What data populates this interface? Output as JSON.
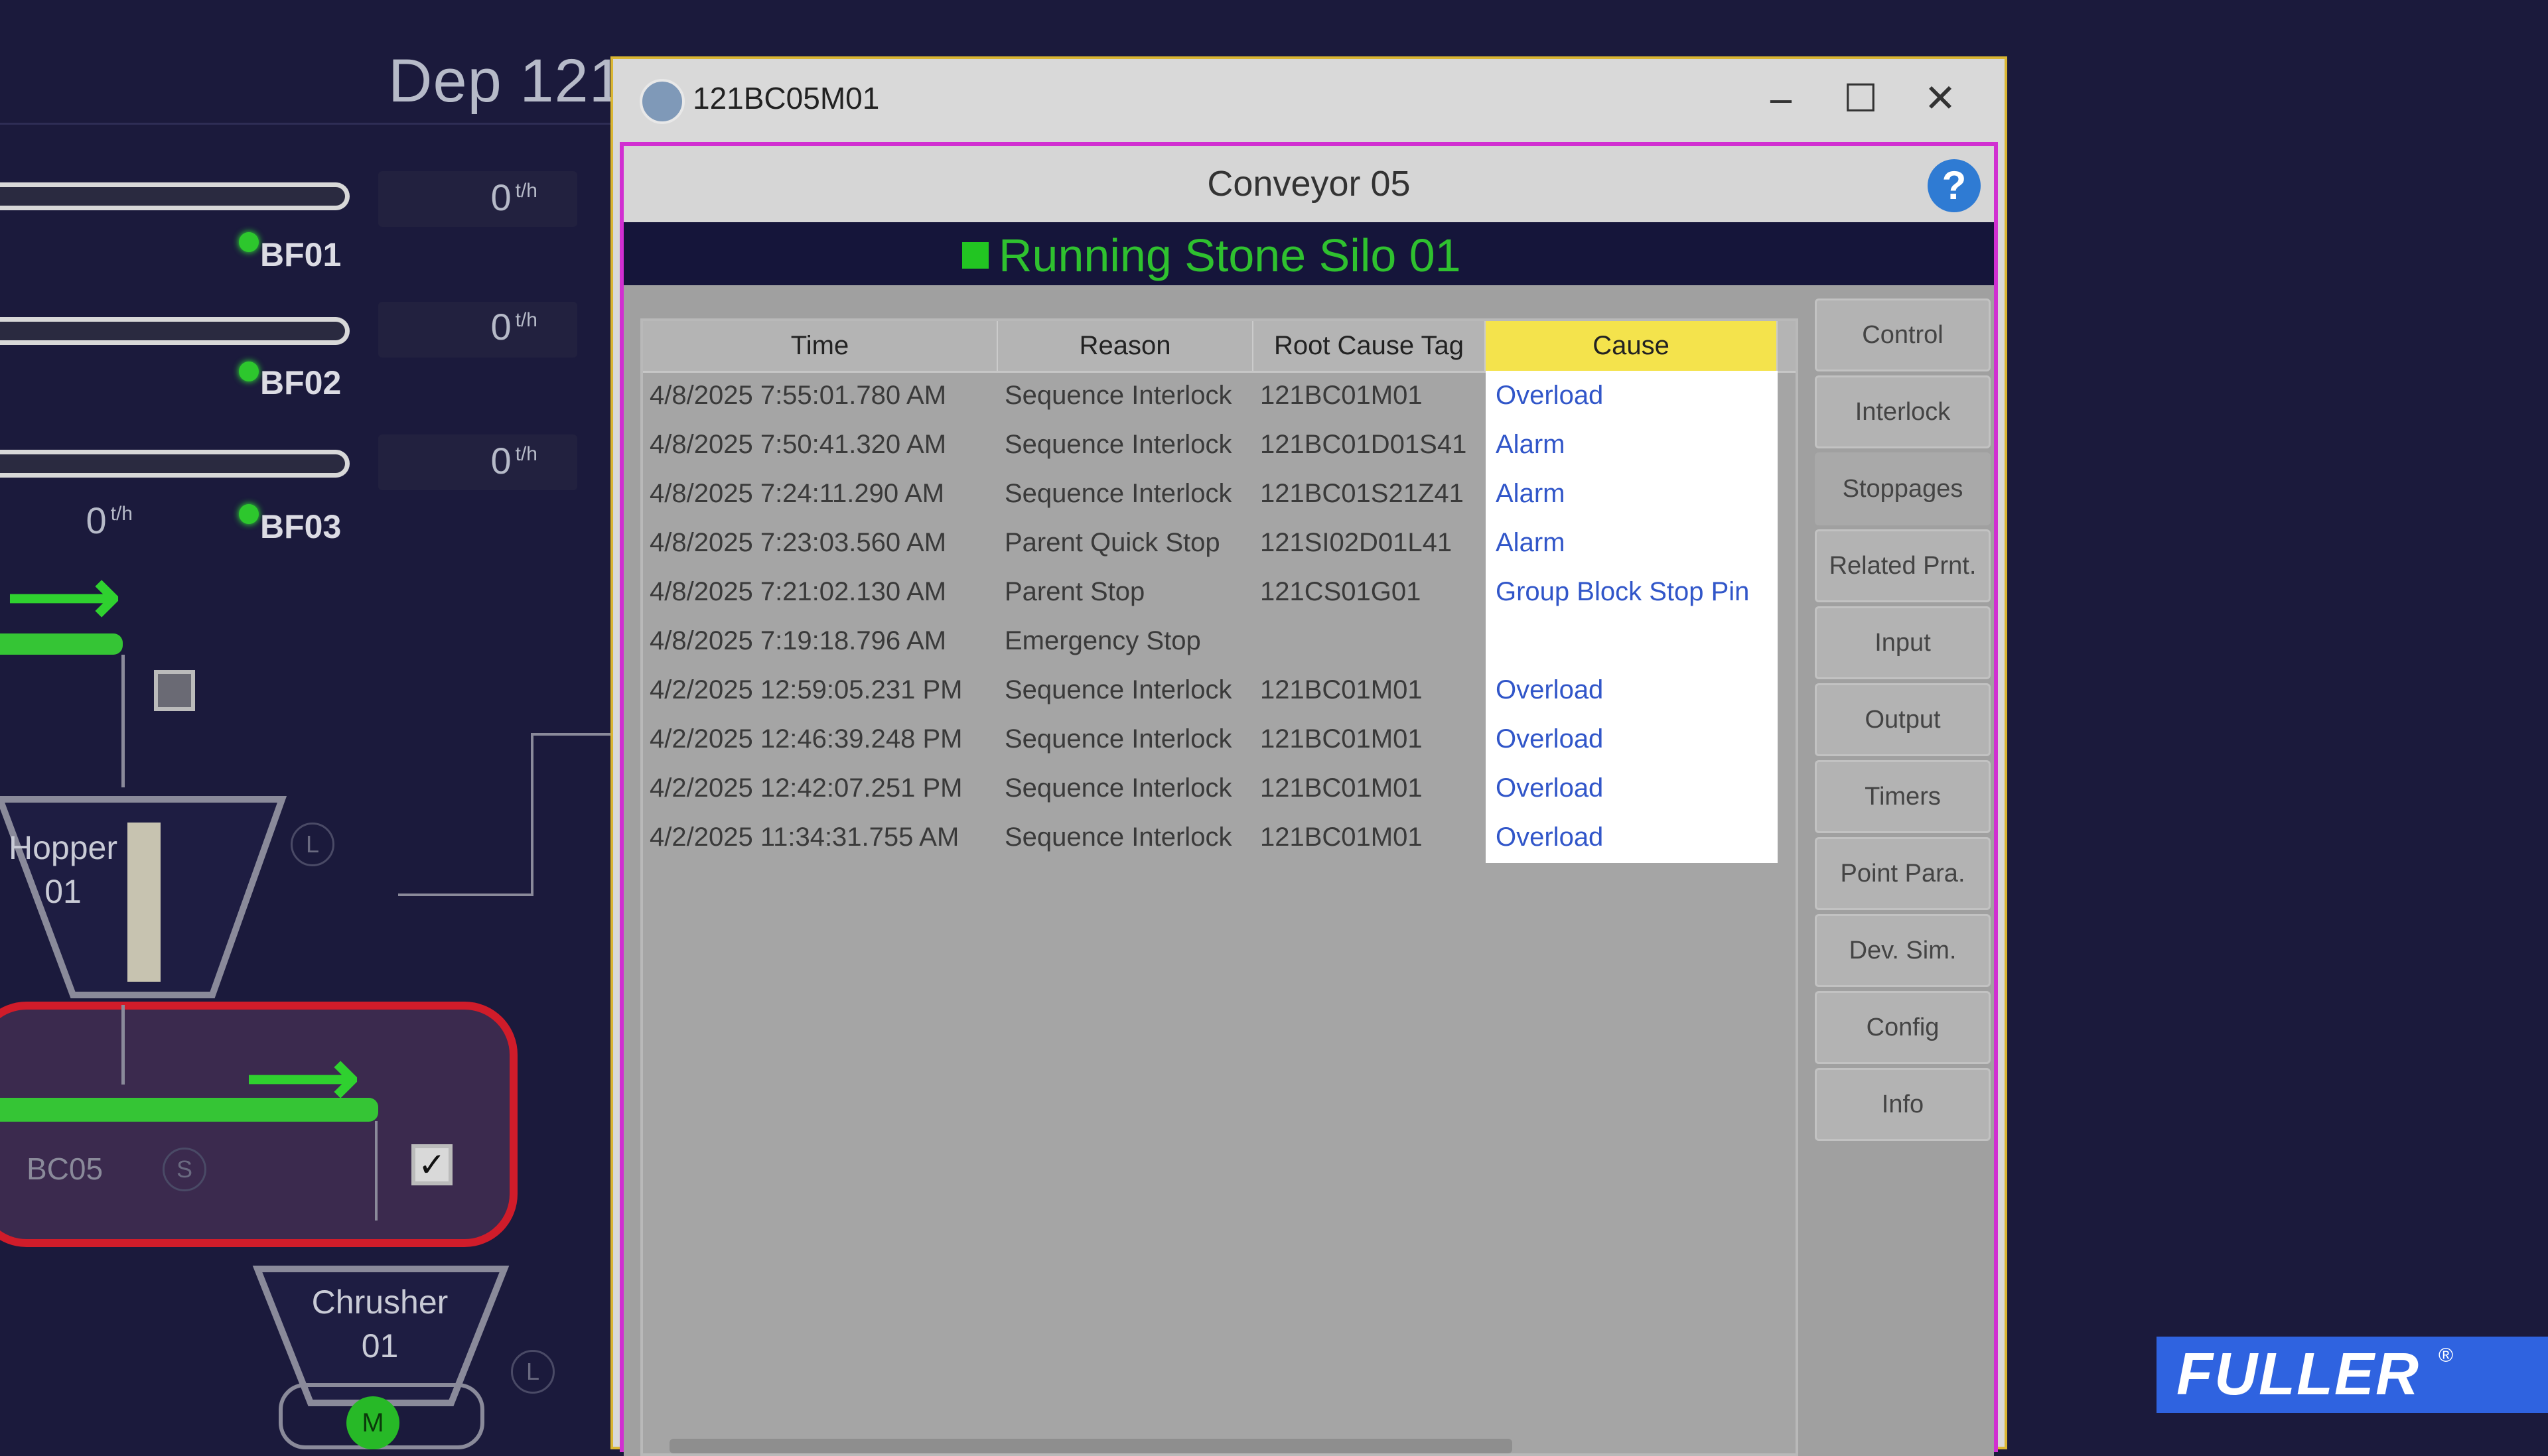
{
  "background": {
    "department_title": "Dep 121",
    "bins": [
      {
        "rate_value": "0",
        "rate_unit": "t/h",
        "label": "BF01"
      },
      {
        "rate_value": "0",
        "rate_unit": "t/h",
        "label": "BF02"
      },
      {
        "rate_value": "0",
        "rate_unit": "t/h",
        "label": "BF03"
      }
    ],
    "feeder_rate": {
      "value": "0",
      "unit": "t/h"
    },
    "hopper": {
      "line1": "Hopper",
      "line2": "01",
      "indicator": "L"
    },
    "conveyor": {
      "label": "BC05",
      "indicator": "S",
      "checkbox": "✓"
    },
    "crusher": {
      "line1": "Chrusher",
      "line2": "01",
      "indicator": "L",
      "motor": "M"
    },
    "colors": {
      "running_green": "#2fc12f",
      "selected_outline": "#d01c2a",
      "bg": "#1b1a3c"
    }
  },
  "window": {
    "title": "121BC05M01",
    "controls": {
      "minimize": "–",
      "maximize": "☐",
      "close": "✕"
    },
    "device_name": "Conveyor 05",
    "help_icon": "?",
    "status": "Running Stone Silo 01",
    "stoppages": {
      "columns": [
        "Time",
        "Reason",
        "Root Cause Tag",
        "Cause"
      ],
      "rows": [
        {
          "time": "4/8/2025 7:55:01.780 AM",
          "reason": "Sequence Interlock",
          "tag": "121BC01M01",
          "cause": "Overload"
        },
        {
          "time": "4/8/2025 7:50:41.320 AM",
          "reason": "Sequence Interlock",
          "tag": "121BC01D01S41",
          "cause": "Alarm"
        },
        {
          "time": "4/8/2025 7:24:11.290 AM",
          "reason": "Sequence Interlock",
          "tag": "121BC01S21Z41",
          "cause": "Alarm"
        },
        {
          "time": "4/8/2025 7:23:03.560 AM",
          "reason": "Parent Quick Stop",
          "tag": "121SI02D01L41",
          "cause": "Alarm"
        },
        {
          "time": "4/8/2025 7:21:02.130 AM",
          "reason": "Parent Stop",
          "tag": "121CS01G01",
          "cause": "Group Block Stop Pin"
        },
        {
          "time": "4/8/2025 7:19:18.796 AM",
          "reason": "Emergency Stop",
          "tag": "",
          "cause": ""
        },
        {
          "time": "4/2/2025 12:59:05.231 PM",
          "reason": "Sequence Interlock",
          "tag": "121BC01M01",
          "cause": "Overload"
        },
        {
          "time": "4/2/2025 12:46:39.248 PM",
          "reason": "Sequence Interlock",
          "tag": "121BC01M01",
          "cause": "Overload"
        },
        {
          "time": "4/2/2025 12:42:07.251 PM",
          "reason": "Sequence Interlock",
          "tag": "121BC01M01",
          "cause": "Overload"
        },
        {
          "time": "4/2/2025 11:34:31.755 AM",
          "reason": "Sequence Interlock",
          "tag": "121BC01M01",
          "cause": "Overload"
        }
      ]
    },
    "tabs": [
      "Control",
      "Interlock",
      "Stoppages",
      "Related Prnt.",
      "Input",
      "Output",
      "Timers",
      "Point Para.",
      "Dev. Sim.",
      "Config",
      "Info"
    ],
    "active_tab": "Stoppages"
  },
  "logo": {
    "text": "FULLER",
    "mark": "®"
  }
}
